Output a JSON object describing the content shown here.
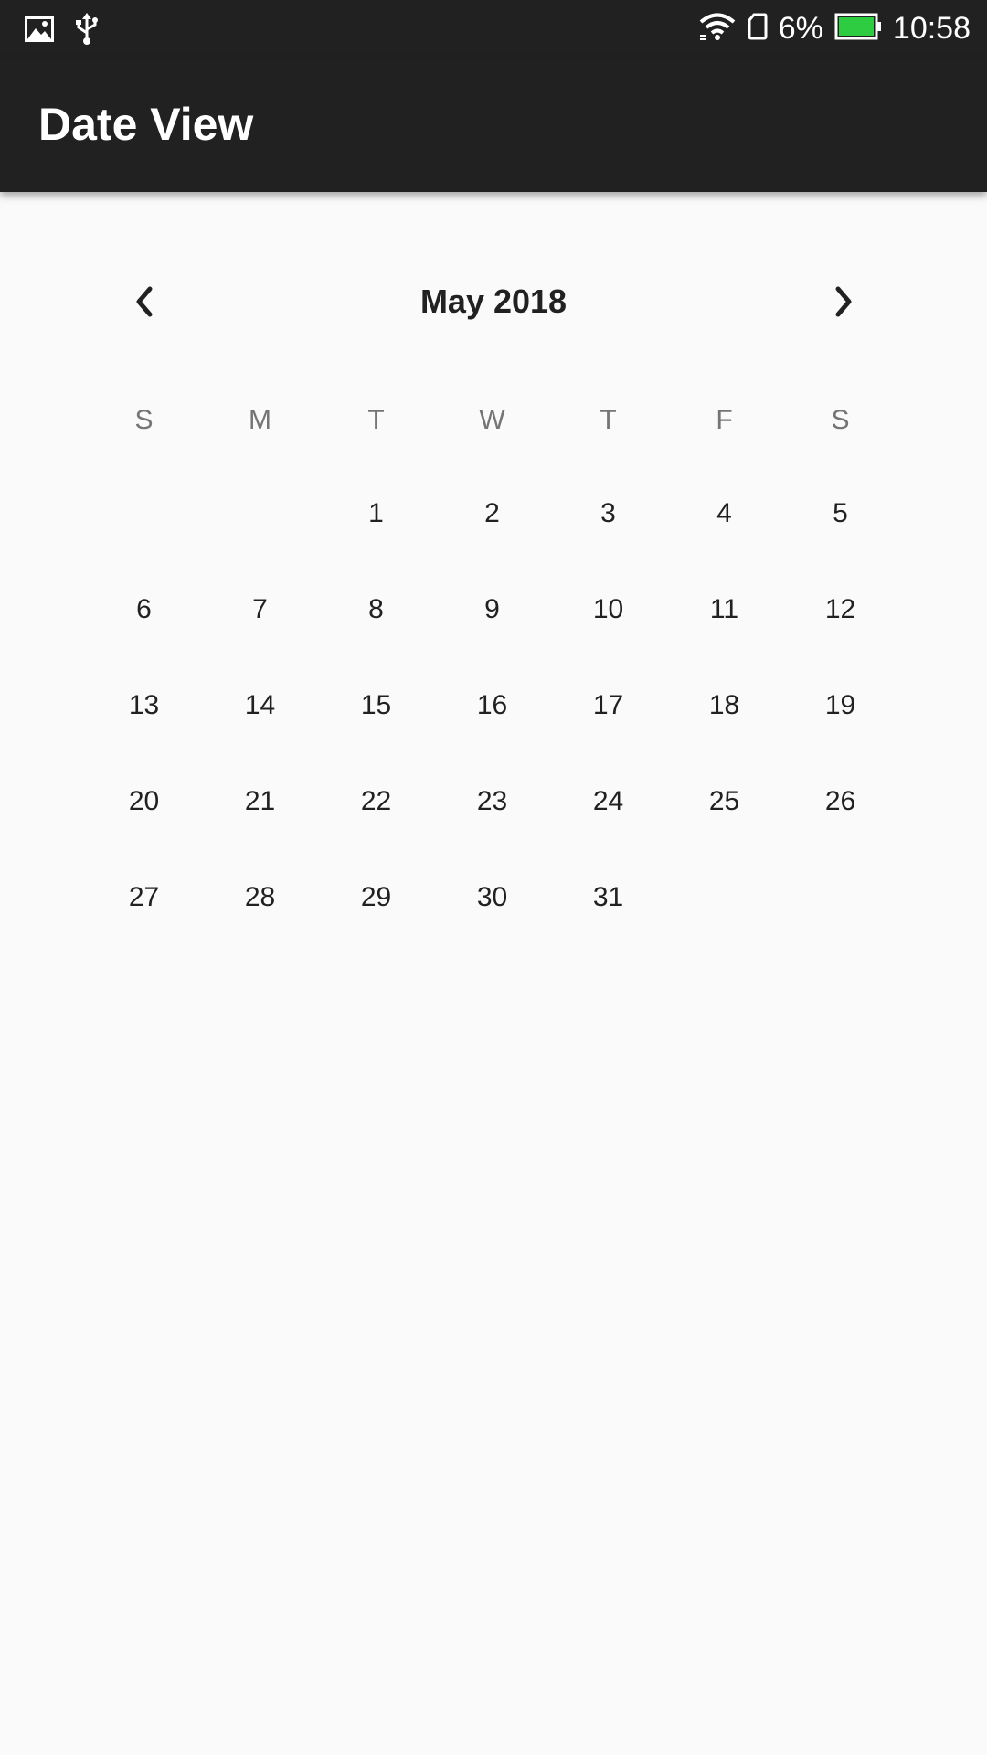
{
  "status_bar": {
    "battery_percent": "6%",
    "time": "10:58",
    "icons": [
      "image-icon",
      "usb-icon",
      "wifi-icon",
      "sim-card-icon",
      "battery-icon"
    ],
    "battery_color": "#2ecc40"
  },
  "app_bar": {
    "title": "Date View",
    "background": "#212121"
  },
  "calendar": {
    "month_label": "May 2018",
    "prev_icon": "chevron-left-icon",
    "next_icon": "chevron-right-icon",
    "weekdays": [
      "S",
      "M",
      "T",
      "W",
      "T",
      "F",
      "S"
    ],
    "weeks": [
      [
        "",
        "",
        "1",
        "2",
        "3",
        "4",
        "5"
      ],
      [
        "6",
        "7",
        "8",
        "9",
        "10",
        "11",
        "12"
      ],
      [
        "13",
        "14",
        "15",
        "16",
        "17",
        "18",
        "19"
      ],
      [
        "20",
        "21",
        "22",
        "23",
        "24",
        "25",
        "26"
      ],
      [
        "27",
        "28",
        "29",
        "30",
        "31",
        "",
        ""
      ]
    ]
  }
}
